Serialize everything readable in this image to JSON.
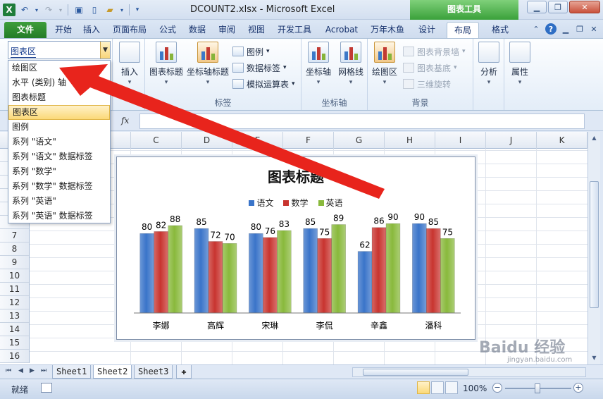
{
  "window": {
    "title": "DCOUNT2.xlsx - Microsoft Excel",
    "context_header": "图表工具"
  },
  "tabs": {
    "file": "文件",
    "items": [
      "开始",
      "插入",
      "页面布局",
      "公式",
      "数据",
      "审阅",
      "视图",
      "开发工具",
      "Acrobat",
      "万年木鱼",
      "设计",
      "布局",
      "格式"
    ],
    "active": "布局"
  },
  "ribbon": {
    "insert": "插入",
    "chart_title": "图表标题",
    "axis_titles": "坐标轴标题",
    "legend": "图例",
    "data_labels": "数据标签",
    "data_table": "模拟运算表",
    "group_labels": "标签",
    "axes": "坐标轴",
    "gridlines": "网格线",
    "group_axes": "坐标轴",
    "plot_area": "绘图区",
    "chart_wall": "图表背景墙",
    "chart_floor": "图表基底",
    "rotation_3d": "三维旋转",
    "group_background": "背景",
    "analysis": "分析",
    "properties": "属性"
  },
  "namebox": {
    "value": "图表区",
    "options": [
      "绘图区",
      "水平 (类别) 轴",
      "图表标题",
      "图表区",
      "图例",
      "系列 \"语文\"",
      "系列 \"语文\" 数据标签",
      "系列 \"数学\"",
      "系列 \"数学\" 数据标签",
      "系列 \"英语\"",
      "系列 \"英语\" 数据标签"
    ],
    "selected": "图表区"
  },
  "formula_bar": {
    "fx": "fx",
    "value": ""
  },
  "columns": [
    "C",
    "D",
    "E",
    "F",
    "G",
    "H",
    "I",
    "J",
    "K"
  ],
  "rows": [
    "7",
    "8",
    "9",
    "10",
    "11",
    "12",
    "13",
    "14",
    "15",
    "16"
  ],
  "sheet_tabs": [
    "Sheet1",
    "Sheet2",
    "Sheet3"
  ],
  "active_sheet": "Sheet2",
  "status": {
    "text": "就绪",
    "zoom": "100%"
  },
  "watermark": {
    "logo": "Baidu 经验",
    "url": "jingyan.baidu.com"
  },
  "colors": {
    "series_chinese": "#3a74c9",
    "series_math": "#c8342f",
    "series_english": "#89b93c",
    "arrow": "#e8241c"
  },
  "chart_data": {
    "type": "bar",
    "title": "图表标题",
    "categories": [
      "李娜",
      "高辉",
      "宋琳",
      "李侃",
      "辛鑫",
      "潘科"
    ],
    "series": [
      {
        "name": "语文",
        "values": [
          80,
          85,
          80,
          85,
          62,
          90
        ]
      },
      {
        "name": "数学",
        "values": [
          82,
          72,
          76,
          75,
          86,
          85
        ]
      },
      {
        "name": "英语",
        "values": [
          88,
          70,
          83,
          89,
          90,
          75
        ]
      }
    ],
    "ylim": [
      0,
      100
    ],
    "legend": "top",
    "data_labels": true,
    "grid": false
  }
}
